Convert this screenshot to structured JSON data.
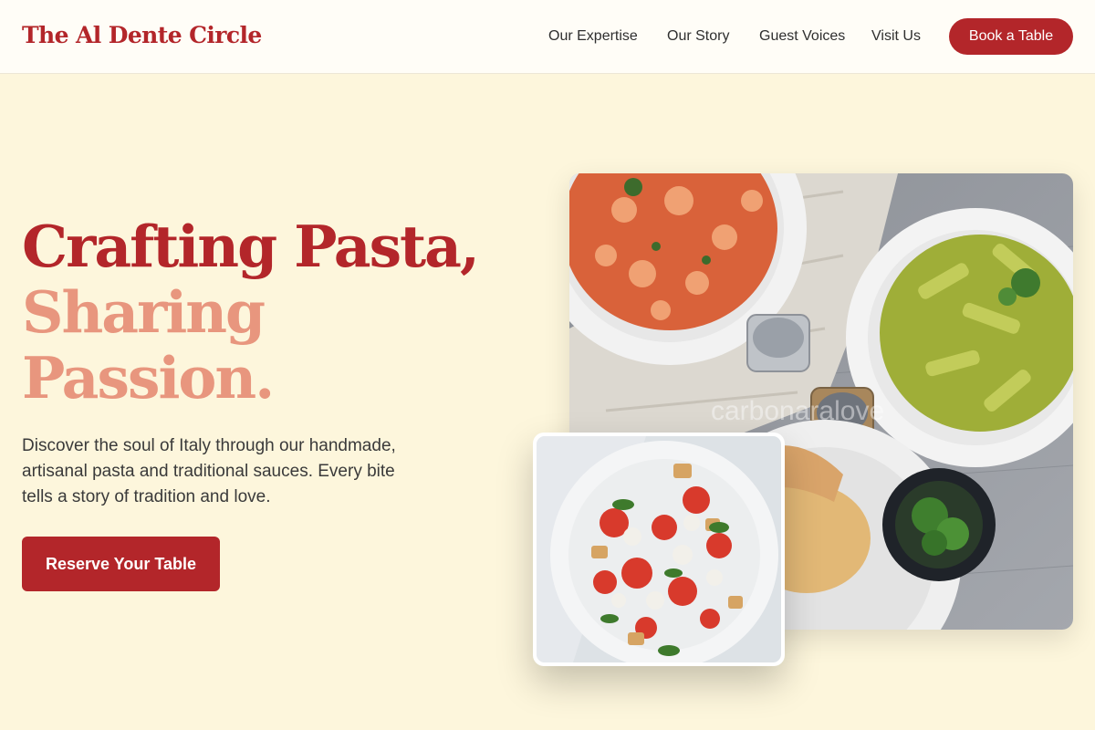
{
  "brand": {
    "name": "The Al Dente Circle"
  },
  "nav": {
    "items": [
      "Our Expertise",
      "Our Story",
      "Guest Voices",
      "Visit Us"
    ],
    "cta_label": "Book a Table"
  },
  "hero": {
    "headline_line1": "Crafting Pasta,",
    "headline_line2": "Sharing",
    "headline_line3": "Passion.",
    "description": "Discover the soul of Italy through our handmade, artisanal pasta and traditional sauces. Every bite tells a story of tradition and love.",
    "cta_label": "Reserve Your Table",
    "watermark_text": "carbonaralove"
  },
  "colors": {
    "accent": "#b3262a",
    "accent_light": "#e8967e",
    "background": "#fdf6dc"
  }
}
